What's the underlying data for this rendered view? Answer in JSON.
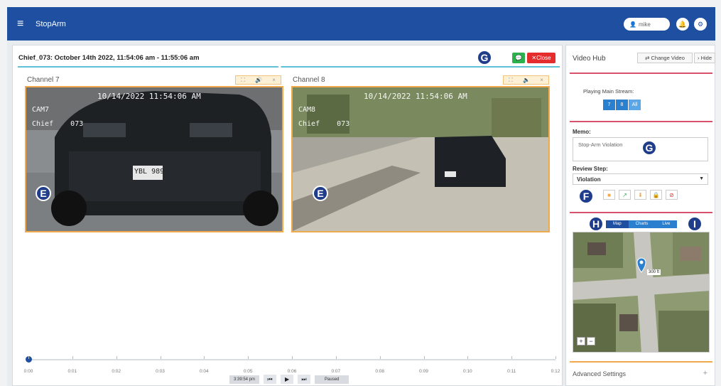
{
  "app": {
    "title": "StopArm",
    "user": "mike"
  },
  "video": {
    "title": "Chief_073: October 14th 2022, 11:54:06 am - 11:55:06 am",
    "close_label": "Close"
  },
  "channels": [
    {
      "label": "Channel 7",
      "stamp_time": "10/14/2022  11:54:06 AM",
      "cam": "CAM7",
      "unit": "Chief    073",
      "plate": "YBL 989"
    },
    {
      "label": "Channel 8",
      "stamp_time": "10/14/2022  11:54:06 AM",
      "cam": "CAM8",
      "unit": "Chief    073"
    }
  ],
  "badges": {
    "e": "E",
    "f": "F",
    "g": "G",
    "h": "H",
    "i": "I"
  },
  "timeline": {
    "labels": [
      "0:00",
      "0:01",
      "0:02",
      "0:03",
      "0:04",
      "0:05",
      "0:06",
      "0:07",
      "0:08",
      "0:09",
      "0:10",
      "0:11",
      "0:12"
    ],
    "current_time": "3:39:54 pm",
    "status": "Paused",
    "progress": 0
  },
  "hub": {
    "title": "Video Hub",
    "change_label": "Change Video",
    "hide_label": "Hide",
    "stream_label": "Playing Main Stream:",
    "streams": [
      "7",
      "8",
      "All"
    ],
    "memo_label": "Memo:",
    "memo_value": "Stop-Arm Violation",
    "review_label": "Review Step:",
    "review_value": "Violation",
    "map_tabs": [
      "Map",
      "Charts",
      "Live"
    ],
    "map_scale": "300 ft",
    "advanced_label": "Advanced Settings"
  },
  "colors": {
    "brand": "#1f4fa0",
    "accent_red": "#e52d2d",
    "accent_green": "#2bb24c",
    "orange": "#f0a94c"
  }
}
